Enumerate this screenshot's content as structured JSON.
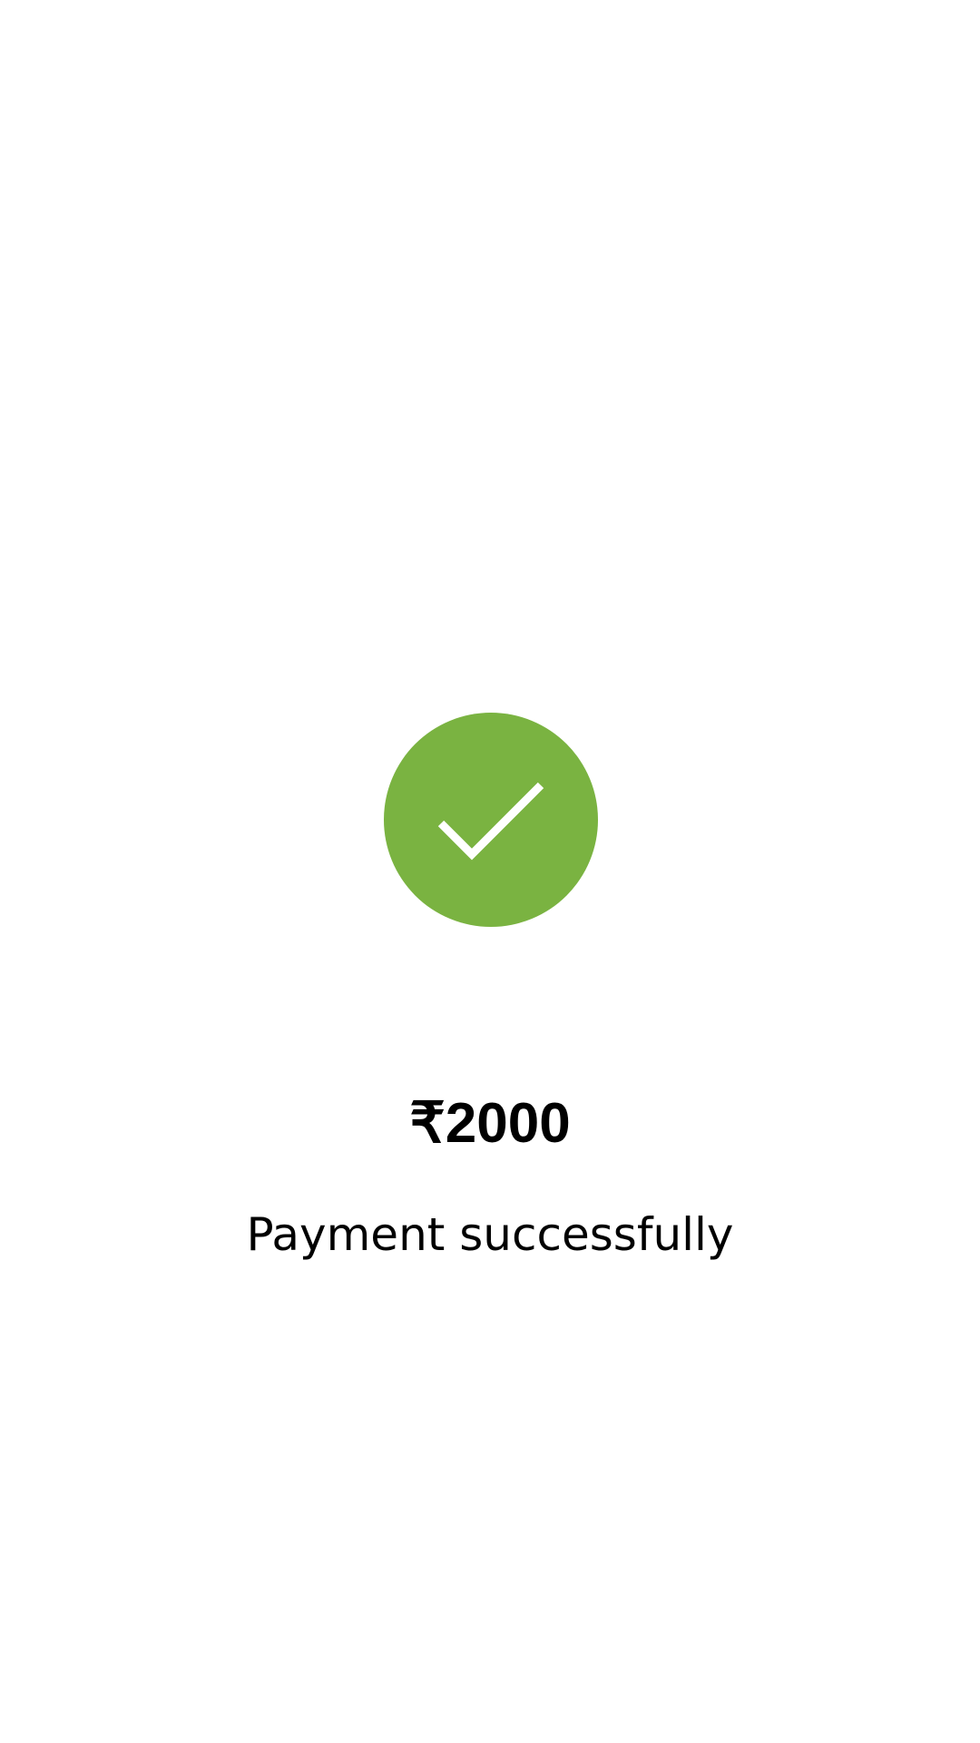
{
  "payment": {
    "amount": "₹2000",
    "message": "Payment successfully"
  },
  "icons": {
    "status": "check-circle-icon"
  },
  "colors": {
    "success": "#7ab341",
    "checkmark": "#ffffff",
    "background": "#ffffff",
    "text": "#000000"
  }
}
